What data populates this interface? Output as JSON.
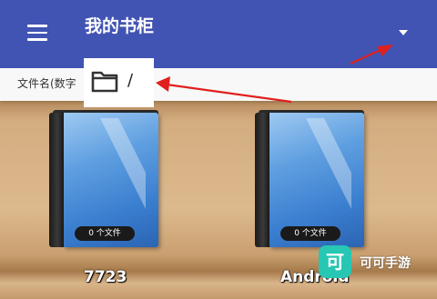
{
  "header": {
    "title": "我的书柜",
    "menu_icon": "hamburger-menu-icon",
    "dropdown_icon": "triangle-down-icon"
  },
  "subbar": {
    "sort_label": "文件名(数字",
    "path": "/",
    "folder_icon": "folder-icon"
  },
  "books": [
    {
      "name": "7723",
      "badge": "0 个文件"
    },
    {
      "name": "Android",
      "badge": "0 个文件"
    }
  ],
  "watermark": {
    "logo_char": "可",
    "text": "可可手游"
  },
  "colors": {
    "appbar": "#4154b3",
    "annotation_arrow": "#e0201e",
    "book_cover": "#3b7fd0",
    "watermark": "#27c7b4"
  }
}
